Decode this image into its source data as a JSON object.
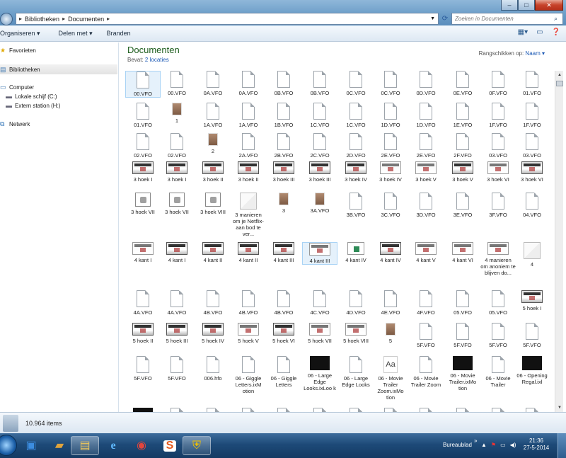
{
  "address": {
    "crumbs": [
      "Bibliotheken",
      "Documenten"
    ],
    "search_placeholder": "Zoeken in Documenten"
  },
  "toolbar": {
    "organize": "Organiseren ▾",
    "share": "Delen met ▾",
    "burn": "Branden"
  },
  "sidebar": {
    "favorites": "Favorieten",
    "libraries": "Bibliotheken",
    "computer": "Computer",
    "local_disk": "Lokale schijf (C:)",
    "external": "Extern station (H:)",
    "network": "Netwerk"
  },
  "library": {
    "title": "Documenten",
    "contains_label": "Bevat:",
    "contains_link": "2 locaties",
    "arrange_label": "Rangschikken op:",
    "arrange_value": "Naam ▾"
  },
  "files": [
    [
      "00.VFO",
      "00.VFO",
      "0A.VFO",
      "0A.VFO",
      "0B.VFO",
      "0B.VFO",
      "0C.VFO",
      "0C.VFO",
      "0D.VFO",
      "0E.VFO",
      "0F.VFO",
      "01.VFO"
    ],
    [
      "01.VFO",
      "1",
      "1A.VFO",
      "1A.VFO",
      "1B.VFO",
      "1C.VFO",
      "1C.VFO",
      "1D.VFO",
      "1D.VFO",
      "1E.VFO",
      "1F.VFO",
      "1F.VFO"
    ],
    [
      "02.VFO",
      "02.VFO",
      "2",
      "2A.VFO",
      "2B.VFO",
      "2C.VFO",
      "2D.VFO",
      "2E.VFO",
      "2E.VFO",
      "2F.VFO",
      "03.VFO",
      "03.VFO"
    ],
    [
      "3 hoek I",
      "3 hoek I",
      "3 hoek II",
      "3 hoek II",
      "3 hoek III",
      "3 hoek III",
      "3 hoek IV",
      "3 hoek IV",
      "3 hoek V",
      "3 hoek V",
      "3 hoek VI",
      "3 hoek VI"
    ],
    [
      "3 hoek VII",
      "3 hoek VII",
      "3 hoek VIII",
      "3 manieren om je Netflix-aan bod te ver...",
      "3",
      "3A.VFO",
      "3B.VFO",
      "3C.VFO",
      "3D.VFO",
      "3E.VFO",
      "3F.VFO",
      "04.VFO"
    ],
    [
      "4 kant I",
      "4 kant I",
      "4 kant II",
      "4 kant II",
      "4 kant III",
      "4 kant III",
      "4 kant IV",
      "4 kant IV",
      "4 kant V",
      "4 kant VI",
      "4 manieren om anoniem te blijven do...",
      "4"
    ],
    [
      "4A.VFO",
      "4A.VFO",
      "4B.VFO",
      "4B.VFO",
      "4B.VFO",
      "4C.VFO",
      "4D.VFO",
      "4E.VFO",
      "4F.VFO",
      "05.VFO",
      "05.VFO",
      "5 hoek I"
    ],
    [
      "5 hoek II",
      "5 hoek III",
      "5 hoek IV",
      "5 hoek V",
      "5 hoek VI",
      "5 hoek VII",
      "5 hoek VIII",
      "5",
      "5F.VFO",
      "5F.VFO",
      "5F.VFO",
      "5F.VFO"
    ],
    [
      "5F.VFO",
      "5F.VFO",
      "006.hfo",
      "06 - Giggle Letters.ixM otion",
      "06 - Giggle Letters",
      "06 - Large Edge Looks.ixLoo k",
      "06 - Large Edge Looks",
      "06 - Movie Trailer Zoom.ixMo tion",
      "06 - Movie Trailer Zoom",
      "06 - Movie Trailer.ixMo tion",
      "06 - Movie Trailer",
      "06 - Opening Regal.ixl"
    ]
  ],
  "thumb_text": {
    "giggle": "Giggle Letters",
    "aa": "Aa",
    "movie1": "Movie Trailer",
    "movie2": "Movie Traile"
  },
  "status": {
    "count": "10.964 items"
  },
  "taskbar": {
    "desktop": "Bureaublad",
    "chevron": "»",
    "time": "21:36",
    "date": "27-5-2014"
  },
  "colors": {
    "title_green": "#1e5e1e",
    "link_blue": "#1d5ab5",
    "taskbar": "#1d4a78"
  }
}
